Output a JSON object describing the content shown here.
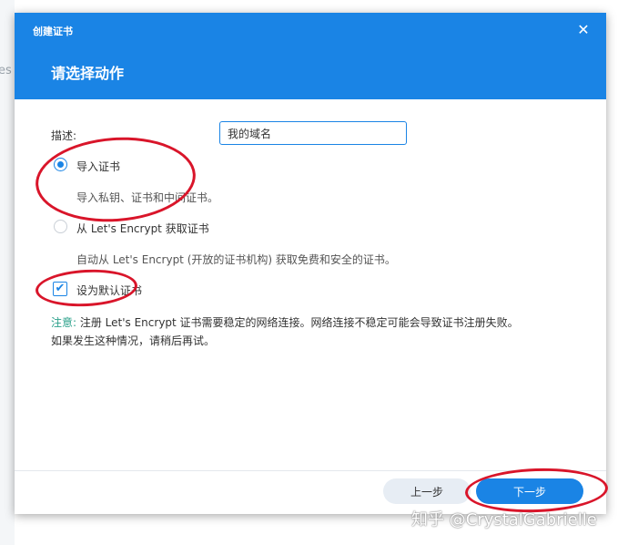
{
  "backdrop": {
    "partial_text": "es"
  },
  "dialog": {
    "window_title": "创建证书",
    "close_icon": "✕",
    "section_title": "请选择动作",
    "description_label": "描述:",
    "description_value": "我的域名",
    "options": [
      {
        "label": "导入证书",
        "desc": "导入私钥、证书和中间证书。",
        "selected": true
      },
      {
        "label": "从 Let's Encrypt 获取证书",
        "desc": "自动从 Let's Encrypt (开放的证书机构) 获取免费和安全的证书。",
        "selected": false
      }
    ],
    "default_checkbox": {
      "label": "设为默认证书",
      "checked": true,
      "check_glyph": "✔"
    },
    "note": {
      "prefix": "注意:",
      "line1": " 注册 Let's Encrypt 证书需要稳定的网络连接。网络连接不稳定可能会导致证书注册失败。",
      "line2": "如果发生这种情况，请稍后再试。"
    },
    "buttons": {
      "prev": "上一步",
      "next": "下一步"
    }
  },
  "watermark": "知乎 @CrystalGabrielle",
  "colors": {
    "accent": "#1a84e5",
    "annotation": "#d9152a",
    "note_prefix": "#2aa08a"
  }
}
